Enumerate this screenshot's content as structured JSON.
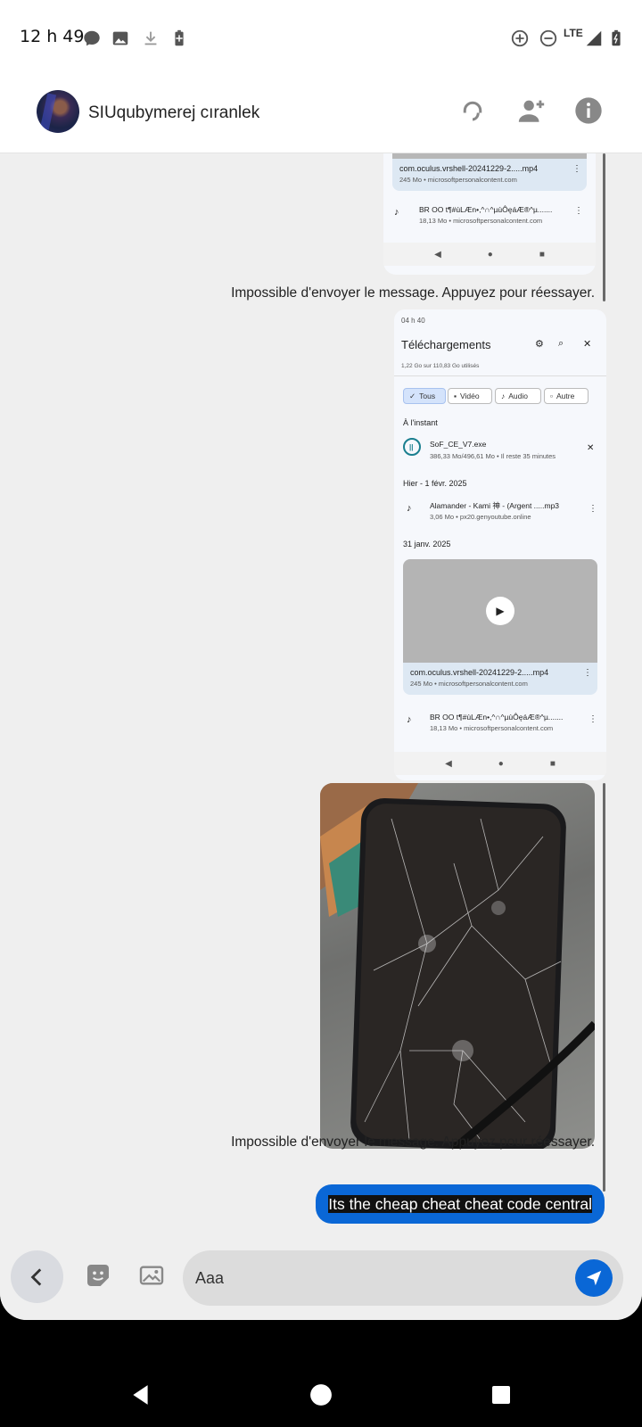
{
  "status_bar": {
    "time": "12 h 49",
    "network": "LTE",
    "icons": [
      "messenger-chat-icon",
      "image-icon",
      "download-icon",
      "battery-saver-icon",
      "data-saver-icon",
      "dnd-icon",
      "signal-icon",
      "battery-icon"
    ]
  },
  "header": {
    "contact_name": "SIUqubymerej cıranlek",
    "buttons": [
      "headset-icon",
      "add-person-icon",
      "info-icon"
    ]
  },
  "messages": {
    "error_text_1": "Impossible d'envoyer le message. Appuyez pour réessayer.",
    "error_text_2": "Impossible d'envoyer le message. Appuyez pour réessayer.",
    "screenshot_top": {
      "file1_name": "com.oculus.vrshell-20241229-2.....mp4",
      "file1_meta": "245 Mo • microsoftpersonalcontent.com",
      "file2_name": "BR OO  t¶#ùLÆn•,^∩^µùÔęáÆ®^µ.......",
      "file2_meta": "18,13 Mo • microsoftpersonalcontent.com"
    },
    "screenshot_main": {
      "status_time": "04 h 40",
      "title": "Téléchargements",
      "storage": "1,22 Go sur 110,83 Go utilisés",
      "chips": [
        "Tous",
        "Vidéo",
        "Audio",
        "Autre"
      ],
      "section_now": "À l'instant",
      "dl_name": "SoF_CE_V7.exe",
      "dl_meta": "386,33 Mo/496,61 Mo • Il reste 35 minutes",
      "section_yesterday": "Hier - 1 févr. 2025",
      "song_name": "Alamander - Kami 神 - (Argent .....mp3",
      "song_meta": "3,06 Mo • px20.genyoutube.online",
      "section_jan": "31 janv. 2025",
      "video_name": "com.oculus.vrshell-20241229-2.....mp4",
      "video_meta": "245 Mo • microsoftpersonalcontent.com",
      "audio_name": "BR OO  t¶#ùLÆn•,^∩^µùÔęáÆ®^µ.......",
      "audio_meta": "18,13 Mo • microsoftpersonalcontent.com"
    },
    "sent_text": "Its the cheap cheat cheat code central"
  },
  "composer": {
    "placeholder": "Aaa"
  }
}
